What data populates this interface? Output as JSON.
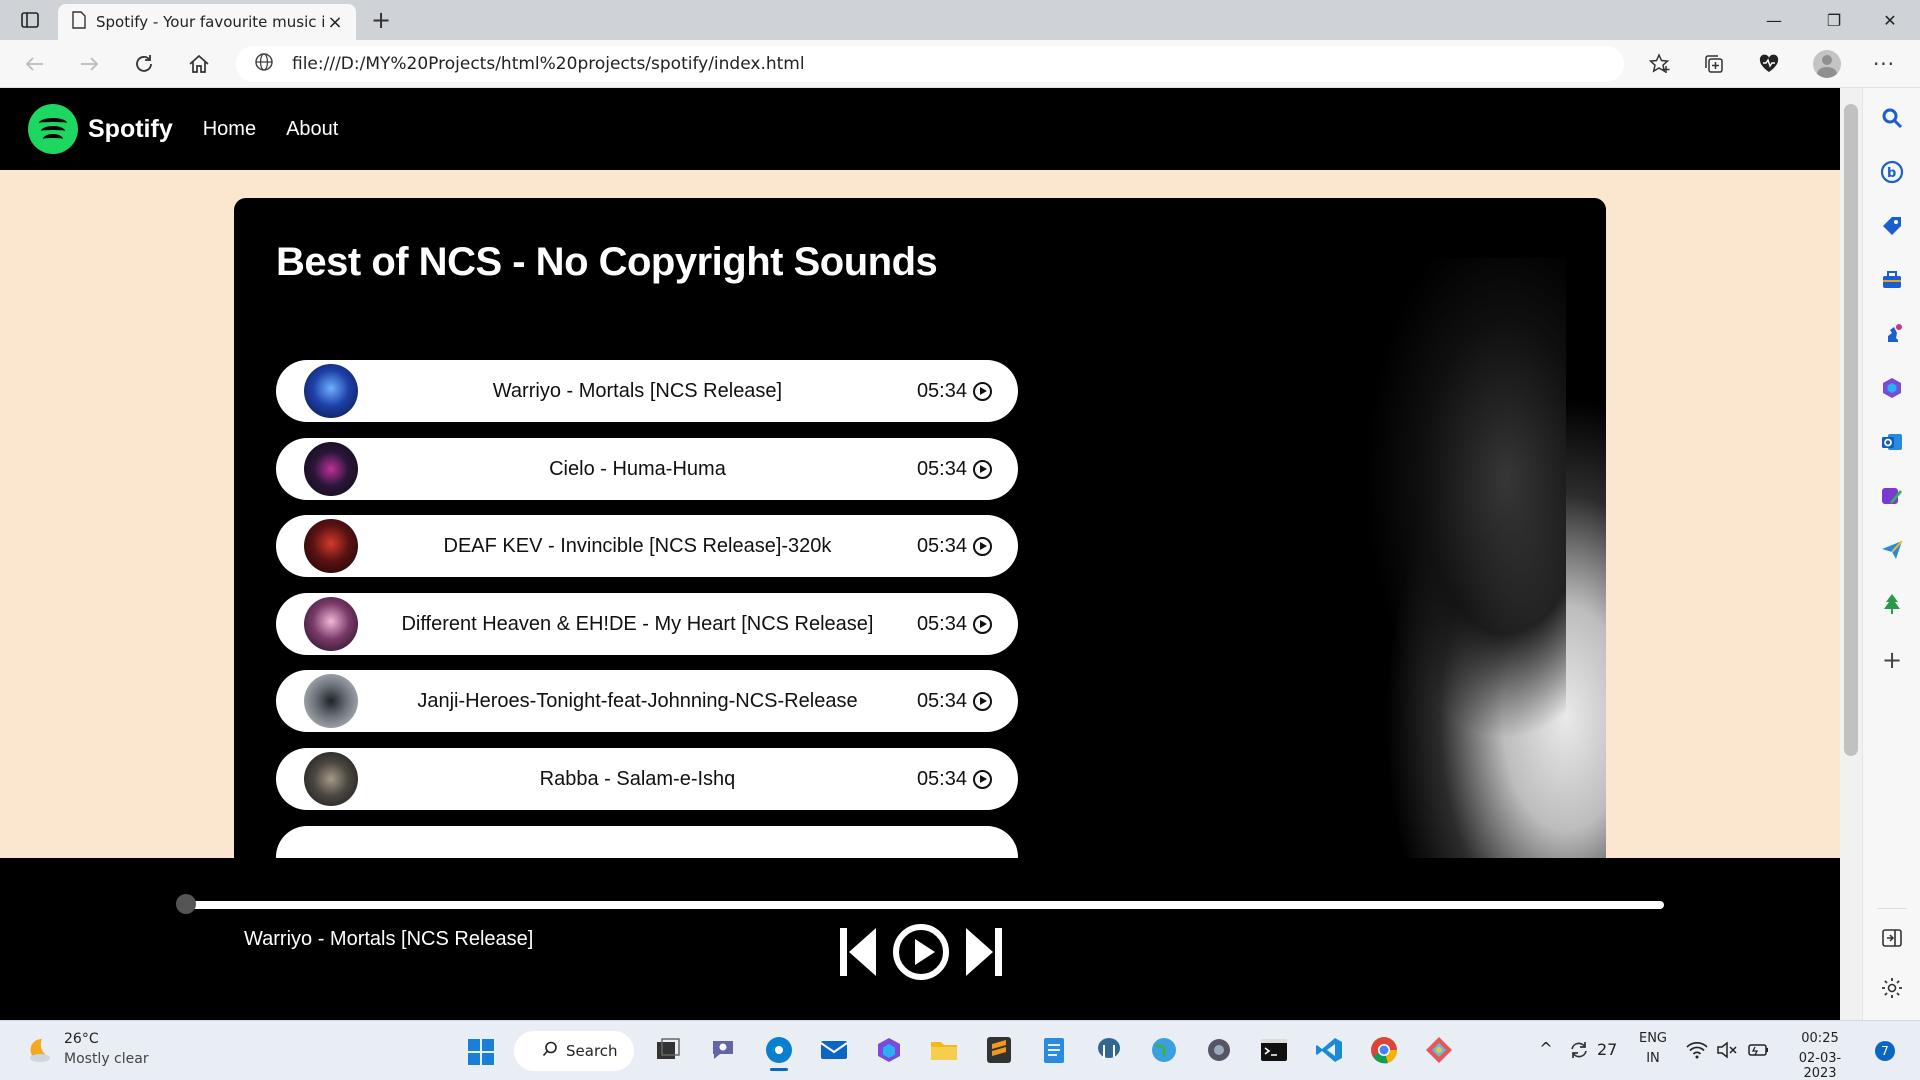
{
  "browser": {
    "tab_title": "Spotify - Your favourite music is h",
    "close_symbol": "×",
    "new_tab_symbol": "+",
    "url": "file:///D:/MY%20Projects/html%20projects/spotify/index.html",
    "window_controls": {
      "minimize": "—",
      "restore": "❐",
      "close": "✕"
    }
  },
  "site": {
    "brand": "Spotify",
    "nav": {
      "home": "Home",
      "about": "About"
    },
    "playlist_title": "Best of NCS - No Copyright Sounds",
    "songs": [
      {
        "name": "Warriyo - Mortals [NCS Release]",
        "duration": "05:34",
        "cover_color": "#1d3fa8"
      },
      {
        "name": "Cielo - Huma-Huma",
        "duration": "05:34",
        "cover_color": "#2a1638"
      },
      {
        "name": "DEAF KEV - Invincible [NCS Release]-320k",
        "duration": "05:34",
        "cover_color": "#5a1212"
      },
      {
        "name": "Different Heaven & EH!DE - My Heart [NCS Release]",
        "duration": "05:34",
        "cover_color": "#7a3a6a"
      },
      {
        "name": "Janji-Heroes-Tonight-feat-Johnning-NCS-Release",
        "duration": "05:34",
        "cover_color": "#6a7078"
      },
      {
        "name": "Rabba - Salam-e-Ishq",
        "duration": "05:34",
        "cover_color": "#4a4640"
      }
    ],
    "player": {
      "now_playing": "Warriyo - Mortals [NCS Release]",
      "progress_fraction": 0
    }
  },
  "taskbar": {
    "weather_temp": "26°C",
    "weather_desc": "Mostly clear",
    "search_label": "Search",
    "notif_count": "27",
    "lang_top": "ENG",
    "lang_bottom": "IN",
    "time": "00:25",
    "date": "02-03-2023",
    "badge": "7"
  },
  "colors": {
    "spotify_green": "#1ed760",
    "page_bg": "#fbe6d0",
    "dark": "#000000",
    "edge_blue": "#0a66c2"
  }
}
